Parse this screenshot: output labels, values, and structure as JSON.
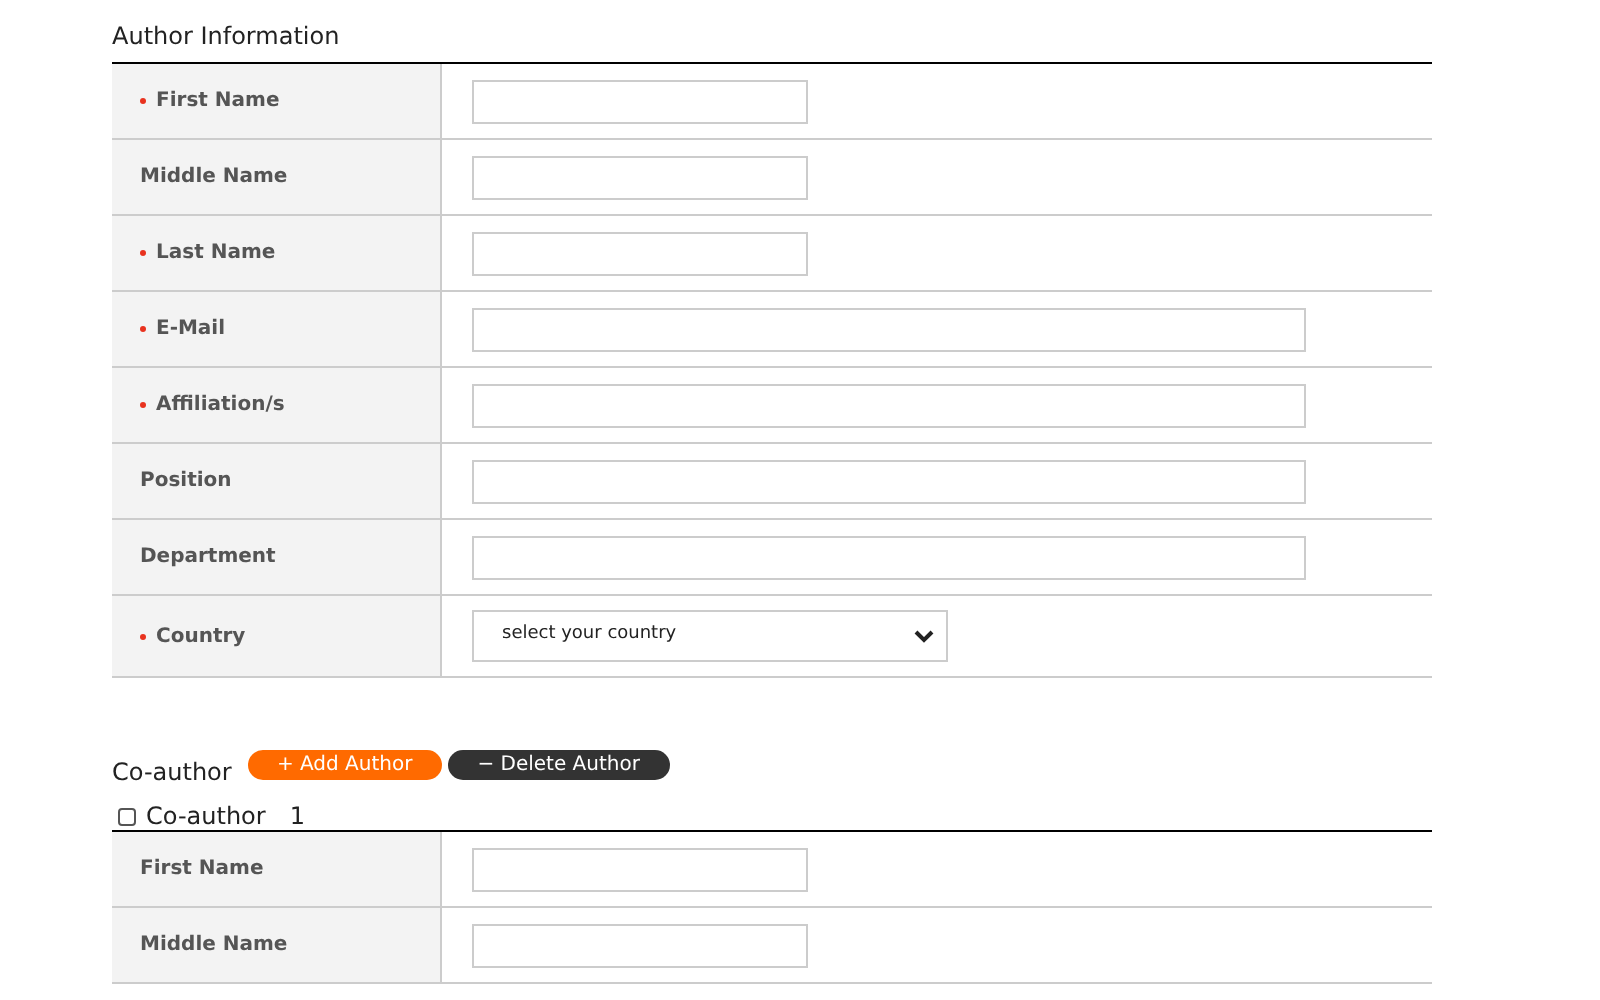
{
  "author_section": {
    "title": "Author Information",
    "fields": [
      {
        "label": "First Name",
        "required": true,
        "kind": "short"
      },
      {
        "label": "Middle Name",
        "required": false,
        "kind": "short"
      },
      {
        "label": "Last Name",
        "required": true,
        "kind": "short"
      },
      {
        "label": "E-Mail",
        "required": true,
        "kind": "long"
      },
      {
        "label": "Affiliation/s",
        "required": true,
        "kind": "long"
      },
      {
        "label": "Position",
        "required": false,
        "kind": "long"
      },
      {
        "label": "Department",
        "required": false,
        "kind": "long"
      },
      {
        "label": "Country",
        "required": true,
        "kind": "select",
        "value": "select your country"
      }
    ]
  },
  "coauthor_section": {
    "title": "Co-author",
    "buttons": [
      {
        "label": "+ Add Author",
        "kind": "add"
      },
      {
        "label": "− Delete Author",
        "kind": "delete"
      }
    ],
    "coauthor": {
      "label": "Co-author",
      "number": "1",
      "checked": false
    },
    "fields": [
      {
        "label": "First Name",
        "required": false,
        "kind": "short"
      },
      {
        "label": "Middle Name",
        "required": false,
        "kind": "short"
      }
    ]
  }
}
